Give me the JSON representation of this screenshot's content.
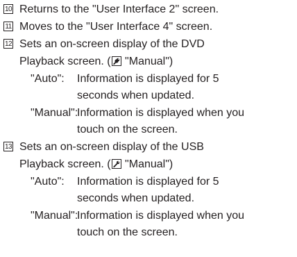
{
  "items": [
    {
      "num": "10",
      "text": "Returns to the \"User Interface 2\" screen."
    },
    {
      "num": "11",
      "text": "Moves to the \"User Interface 4\" screen."
    },
    {
      "num": "12",
      "text_line1": "Sets an on-screen display of the DVD",
      "text_line2_pre": "Playback screen. (",
      "text_line2_post": " \"Manual\")",
      "options": [
        {
          "label": "\"Auto\":",
          "desc_line1": "Information is displayed for 5",
          "desc_line2": "seconds when updated."
        },
        {
          "label": "\"Manual\":",
          "desc_line1": "Information is displayed when you",
          "desc_line2": "touch on the screen."
        }
      ]
    },
    {
      "num": "13",
      "text_line1": "Sets an on-screen display of the USB",
      "text_line2_pre": "Playback screen. (",
      "text_line2_post": " \"Manual\")",
      "options": [
        {
          "label": "\"Auto\":",
          "desc_line1": "Information is displayed for 5",
          "desc_line2": "seconds when updated."
        },
        {
          "label": "\"Manual\":",
          "desc_line1": "Information is displayed when you",
          "desc_line2": "touch on the screen."
        }
      ]
    }
  ],
  "icons": {
    "default_setting": "wrench-icon"
  }
}
